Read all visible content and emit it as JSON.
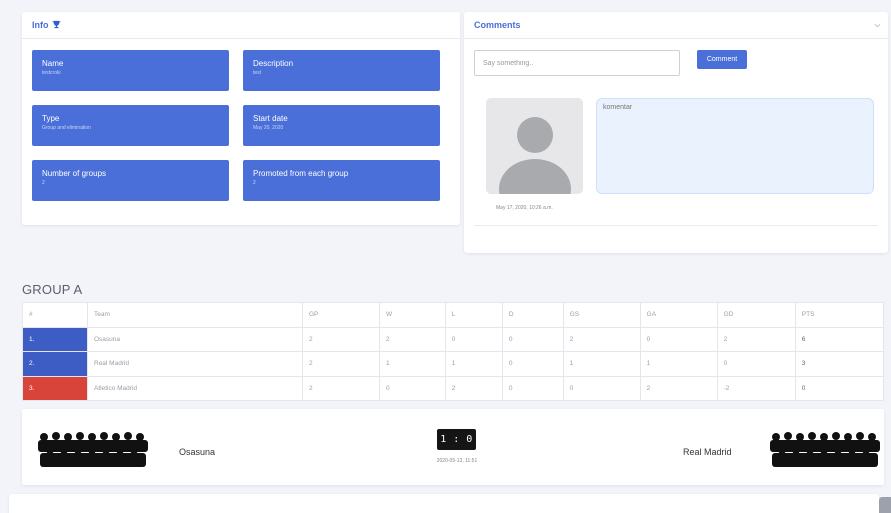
{
  "info": {
    "title": "Info",
    "tiles": [
      {
        "label": "Name",
        "value": "testcroki"
      },
      {
        "label": "Description",
        "value": "test"
      },
      {
        "label": "Type",
        "value": "Group and elimination"
      },
      {
        "label": "Start date",
        "value": "May 20, 2020"
      },
      {
        "label": "Number of groups",
        "value": "2"
      },
      {
        "label": "Promoted from each group",
        "value": "2"
      }
    ]
  },
  "comments": {
    "title": "Comments",
    "input_placeholder": "Say something..",
    "button_label": "Comment",
    "items": [
      {
        "text": "komentar",
        "date": "May 17, 2020, 10:26 a.m."
      }
    ]
  },
  "group": {
    "title": "GROUP A",
    "columns": [
      "#",
      "Team",
      "GP",
      "W",
      "L",
      "D",
      "GS",
      "GA",
      "GD",
      "PTS"
    ],
    "rows": [
      {
        "rank": "1.",
        "team": "Osasuna",
        "gp": "2",
        "w": "2",
        "l": "0",
        "d": "0",
        "gs": "2",
        "ga": "0",
        "gd": "2",
        "pts": "6",
        "color": "#3d5cc4"
      },
      {
        "rank": "2.",
        "team": "Real Madrid",
        "gp": "2",
        "w": "1",
        "l": "1",
        "d": "0",
        "gs": "1",
        "ga": "1",
        "gd": "0",
        "pts": "3",
        "color": "#3d5cc4"
      },
      {
        "rank": "3.",
        "team": "Atletico Madrid",
        "gp": "2",
        "w": "0",
        "l": "2",
        "d": "0",
        "gs": "0",
        "ga": "2",
        "gd": "-2",
        "pts": "0",
        "color": "#d9443a"
      }
    ]
  },
  "match": {
    "home": "Osasuna",
    "away": "Real Madrid",
    "score": "1 : 0",
    "date": "2020-05-13, 11:51"
  },
  "colors": {
    "accent": "#4a6fd8",
    "promoted": "#3d5cc4",
    "relegated": "#d9443a"
  }
}
